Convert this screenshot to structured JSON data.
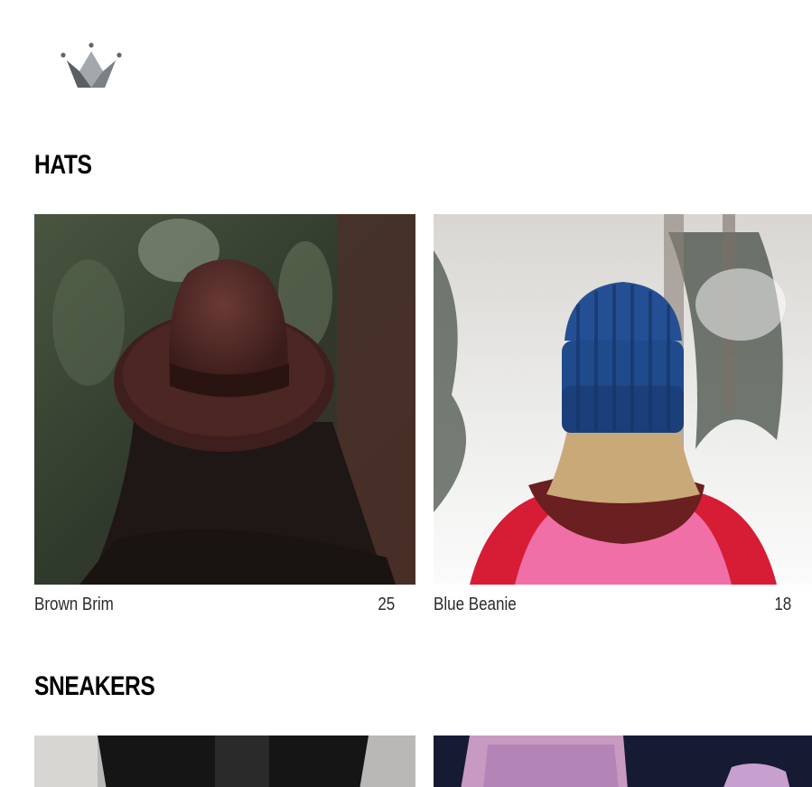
{
  "header": {
    "logo_icon": "crown-icon"
  },
  "sections": [
    {
      "title": "HATS",
      "items": [
        {
          "name": "Brown Brim",
          "price": "25"
        },
        {
          "name": "Blue Beanie",
          "price": "18"
        }
      ]
    },
    {
      "title": "SNEAKERS",
      "items": [
        {
          "name": "",
          "price": ""
        },
        {
          "name": "",
          "price": ""
        }
      ]
    }
  ],
  "colors": {
    "crown_dark": "#5f6469",
    "crown_light": "#9aa0a4",
    "text": "#2b2b2b",
    "heading": "#000000"
  }
}
